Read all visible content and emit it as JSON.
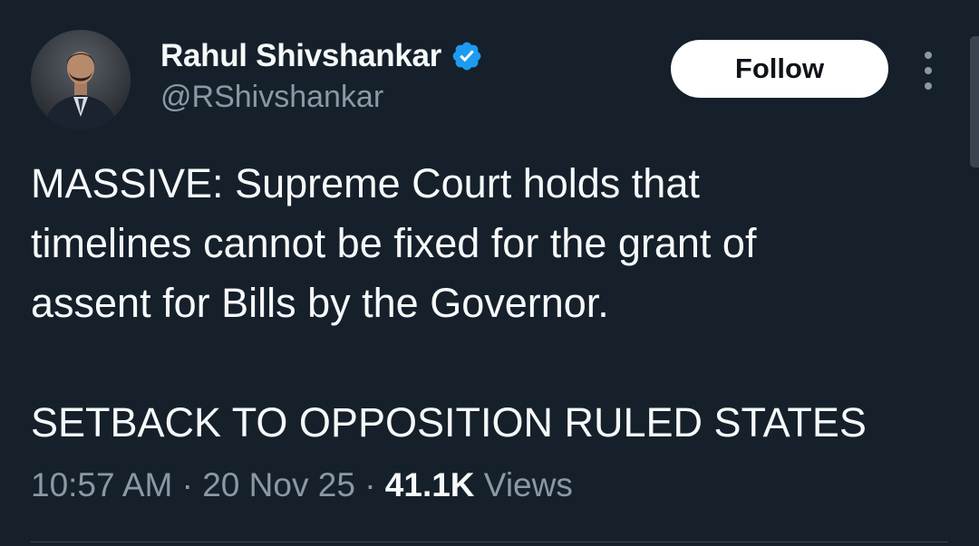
{
  "author": {
    "display_name": "Rahul Shivshankar",
    "handle": "@RShivshankar",
    "verified_icon": "verified-badge-icon",
    "verified_color": "#1d9bf0"
  },
  "actions": {
    "follow_label": "Follow",
    "more_icon": "more-vertical-icon"
  },
  "tweet": {
    "lines": [
      "MASSIVE: Supreme Court holds that",
      "timelines cannot be fixed for the grant of",
      "assent for Bills by the Governor.",
      "",
      "SETBACK TO OPPOSITION RULED STATES"
    ]
  },
  "meta": {
    "time": "10:57 AM",
    "date": "20 Nov 25",
    "separator": "·",
    "views_count": "41.1K",
    "views_label": "Views"
  },
  "colors": {
    "background": "#15202b",
    "text_primary": "#f7f9f9",
    "text_secondary": "#8b98a5",
    "follow_button_bg": "#ffffff"
  }
}
